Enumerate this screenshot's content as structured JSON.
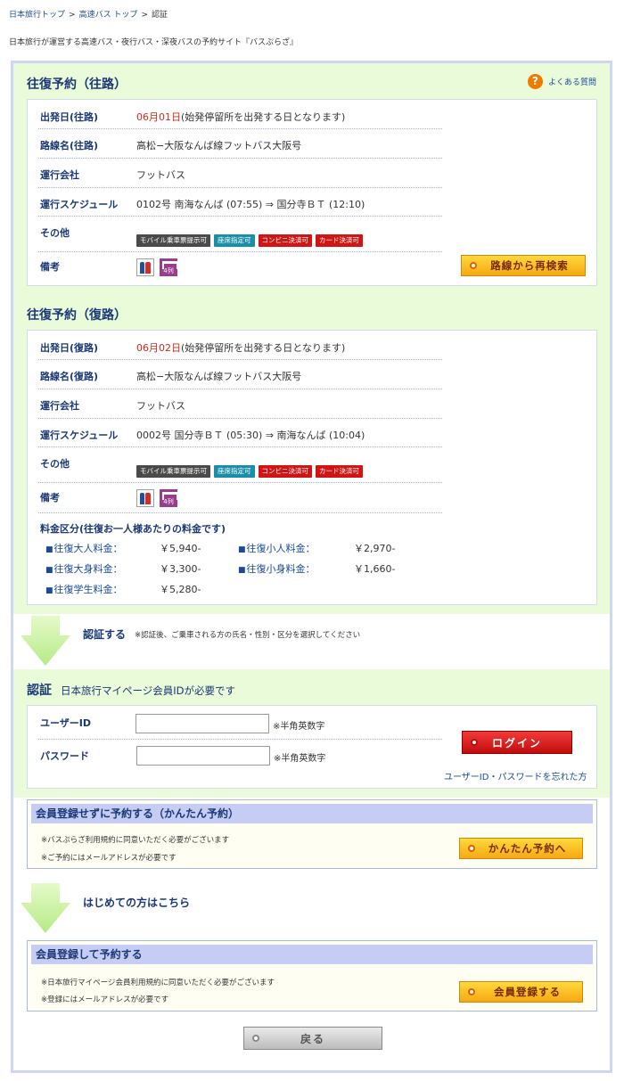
{
  "breadcrumb": {
    "items": [
      "日本旅行トップ",
      "高速バス トップ"
    ],
    "current": "認証",
    "separator": ">"
  },
  "tagline": "日本旅行が運営する高速バス・夜行バス・深夜バスの予約サイト『バスぷらざ』",
  "faq": {
    "icon": "?",
    "label": "よくある質問"
  },
  "outbound": {
    "heading": "往復予約（往路）",
    "date_label": "出発日(往路)",
    "date_value": "06月01日",
    "date_note": "(始発停留所を出発する日となります)",
    "route_label": "路線名(往路)",
    "route_value": "高松−大阪なんば線フットバス大阪号",
    "operator_label": "運行会社",
    "operator_value": "フットバス",
    "schedule_label": "運行スケジュール",
    "schedule_value": "0102号 南海なんば (07:55) ⇒ 国分寺ＢＴ (12:10)",
    "other_label": "その他",
    "badges": [
      "モバイル乗車票提示可",
      "座席指定可",
      "コンビニ決済可",
      "カード決済可"
    ],
    "remarks_label": "備考",
    "seat_icon_text": "4列",
    "research_button": "路線から再検索"
  },
  "return": {
    "heading": "往復予約（復路）",
    "date_label": "出発日(復路)",
    "date_value": "06月02日",
    "date_note": "(始発停留所を出発する日となります)",
    "route_label": "路線名(復路)",
    "route_value": "高松−大阪なんば線フットバス大阪号",
    "operator_label": "運行会社",
    "operator_value": "フットバス",
    "schedule_label": "運行スケジュール",
    "schedule_value": "0002号 国分寺ＢＴ (05:30) ⇒ 南海なんば (10:04)",
    "other_label": "その他",
    "badges": [
      "モバイル乗車票提示可",
      "座席指定可",
      "コンビニ決済可",
      "カード決済可"
    ],
    "remarks_label": "備考",
    "seat_icon_text": "4列"
  },
  "fares": {
    "title": "料金区分(往復お一人様あたりの料金です)",
    "items": [
      {
        "label": "往復大人料金：",
        "value": "￥5,940-"
      },
      {
        "label": "往復小人料金：",
        "value": "￥2,970-"
      },
      {
        "label": "往復大身料金：",
        "value": "￥3,300-"
      },
      {
        "label": "往復小身料金：",
        "value": "￥1,660-"
      },
      {
        "label": "往復学生料金：",
        "value": "￥5,280-"
      }
    ]
  },
  "step_auth": {
    "title": "認証する",
    "note": "※認証後、ご乗車される方の氏名・性別・区分を選択してください"
  },
  "auth": {
    "heading": "認証",
    "subheading": "日本旅行マイページ会員IDが必要です",
    "user_label": "ユーザーID",
    "user_value": "",
    "password_label": "パスワード",
    "password_value": "",
    "hint": "※半角英数字",
    "login_button": "ログイン",
    "forgot_link": "ユーザーID・パスワードを忘れた方"
  },
  "easy": {
    "heading": "会員登録せずに予約する（かんたん予約）",
    "note1": "※バスぷらざ利用規約に同意いただく必要がございます",
    "note2": "※ご予約にはメールアドレスが必要です",
    "button": "かんたん予約へ"
  },
  "step_first": {
    "title": "はじめての方はこちら"
  },
  "register": {
    "heading": "会員登録して予約する",
    "note1": "※日本旅行マイページ会員利用規約に同意いただく必要がございます",
    "note2": "※登録にはメールアドレスが必要です",
    "button": "会員登録する"
  },
  "back_button": "戻る",
  "colors": {
    "heading": "#1a3876",
    "link": "#1a4a9e",
    "date_red": "#d42b1a",
    "green_bg": "#e9fbd9",
    "border_blue": "#cdd7f2"
  }
}
